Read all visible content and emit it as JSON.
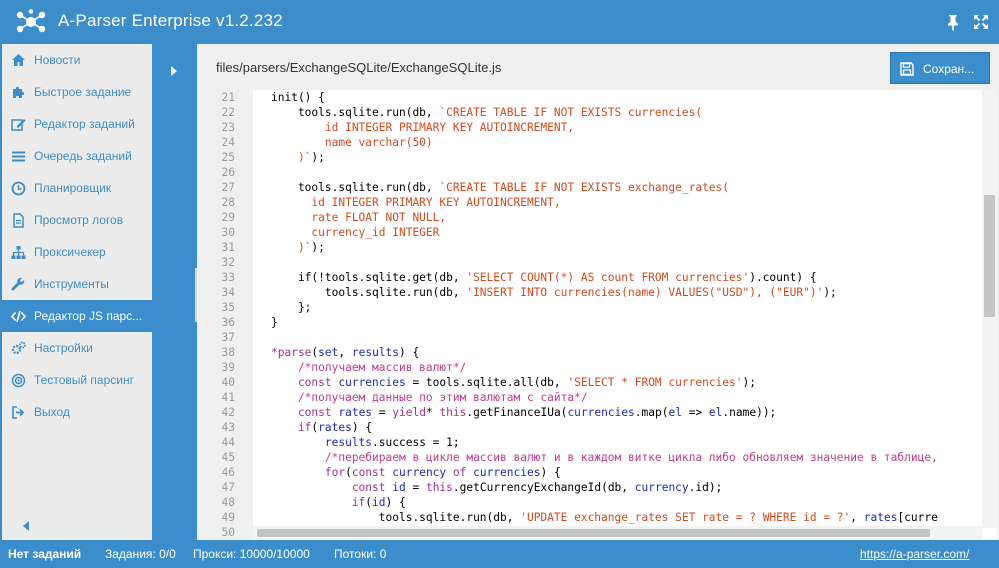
{
  "app": {
    "title": "A-Parser Enterprise v1.2.232"
  },
  "icons": {
    "logo": "a-parser-logo-icon",
    "pin": "pin-icon",
    "fullscreen": "fullscreen-icon"
  },
  "colors": {
    "accent": "#3c8dcb",
    "sidebar_bg": "#ececec",
    "active_bg": "#3c8dcb",
    "string": "#d14b1e",
    "comment": "#c43c8a",
    "keyword": "#a0328e",
    "variable": "#1f2ab0"
  },
  "sidebar": {
    "items": [
      {
        "label": "Новости",
        "icon": "home-icon",
        "active": false
      },
      {
        "label": "Быстрое задание",
        "icon": "puzzle-icon",
        "active": false
      },
      {
        "label": "Редактор заданий",
        "icon": "edit-icon",
        "active": false
      },
      {
        "label": "Очередь заданий",
        "icon": "list-icon",
        "active": false
      },
      {
        "label": "Планировщик",
        "icon": "clock-icon",
        "active": false
      },
      {
        "label": "Просмотр логов",
        "icon": "file-icon",
        "active": false
      },
      {
        "label": "Проксичекер",
        "icon": "sitemap-icon",
        "active": false
      },
      {
        "label": "Инструменты",
        "icon": "wrench-icon",
        "active": false
      },
      {
        "label": "Редактор JS парс...",
        "icon": "code-icon",
        "active": true
      },
      {
        "label": "Настройки",
        "icon": "gears-icon",
        "active": false
      },
      {
        "label": "Тестовый парсинг",
        "icon": "target-icon",
        "active": false
      },
      {
        "label": "Выход",
        "icon": "signout-icon",
        "active": false
      }
    ]
  },
  "content": {
    "file_path": "files/parsers/ExchangeSQLite/ExchangeSQLite.js",
    "save_label": "Сохран...",
    "save_icon": "save-icon"
  },
  "editor": {
    "lines": [
      {
        "num": "21",
        "tokens": [
          [
            "d",
            "init() {"
          ]
        ]
      },
      {
        "num": "22",
        "tokens": [
          [
            "d",
            "    tools.sqlite.run(db, "
          ],
          [
            "s",
            "`CREATE TABLE IF NOT EXISTS currencies("
          ]
        ]
      },
      {
        "num": "23",
        "tokens": [
          [
            "s",
            "        id INTEGER PRIMARY KEY AUTOINCREMENT,"
          ]
        ]
      },
      {
        "num": "24",
        "tokens": [
          [
            "s",
            "        name varchar(50)"
          ]
        ]
      },
      {
        "num": "25",
        "tokens": [
          [
            "s",
            "    )`"
          ],
          [
            "d",
            ");"
          ]
        ]
      },
      {
        "num": "26",
        "tokens": []
      },
      {
        "num": "27",
        "tokens": [
          [
            "d",
            "    tools.sqlite.run(db, "
          ],
          [
            "s",
            "`CREATE TABLE IF NOT EXISTS exchange_rates("
          ]
        ]
      },
      {
        "num": "28",
        "tokens": [
          [
            "s",
            "      id INTEGER PRIMARY KEY AUTOINCREMENT,"
          ]
        ]
      },
      {
        "num": "29",
        "tokens": [
          [
            "s",
            "      rate FLOAT NOT NULL,"
          ]
        ]
      },
      {
        "num": "30",
        "tokens": [
          [
            "s",
            "      currency_id INTEGER"
          ]
        ]
      },
      {
        "num": "31",
        "tokens": [
          [
            "s",
            "    )`"
          ],
          [
            "d",
            ");"
          ]
        ]
      },
      {
        "num": "32",
        "tokens": []
      },
      {
        "num": "33",
        "tokens": [
          [
            "d",
            "    if(!tools.sqlite.get(db, "
          ],
          [
            "s",
            "'SELECT COUNT(*) AS count FROM currencies'"
          ],
          [
            "d",
            ").count) {"
          ]
        ]
      },
      {
        "num": "34",
        "tokens": [
          [
            "d",
            "        tools.sqlite.run(db, "
          ],
          [
            "s",
            "'INSERT INTO currencies(name) VALUES(\"USD\"), (\"EUR\")'"
          ],
          [
            "d",
            ");"
          ]
        ]
      },
      {
        "num": "35",
        "tokens": [
          [
            "d",
            "    };"
          ]
        ]
      },
      {
        "num": "36",
        "tokens": [
          [
            "d",
            "}"
          ]
        ]
      },
      {
        "num": "37",
        "tokens": []
      },
      {
        "num": "38",
        "tokens": [
          [
            "k",
            "*parse"
          ],
          [
            "d",
            "("
          ],
          [
            "v",
            "set"
          ],
          [
            "d",
            ", "
          ],
          [
            "v",
            "results"
          ],
          [
            "d",
            ") {"
          ]
        ]
      },
      {
        "num": "39",
        "tokens": [
          [
            "c",
            "    /*получаем массив валют*/"
          ]
        ]
      },
      {
        "num": "40",
        "tokens": [
          [
            "k",
            "    const "
          ],
          [
            "v",
            "currencies"
          ],
          [
            "d",
            " = tools.sqlite.all(db, "
          ],
          [
            "s",
            "'SELECT * FROM currencies'"
          ],
          [
            "d",
            ");"
          ]
        ]
      },
      {
        "num": "41",
        "tokens": [
          [
            "c",
            "    /*получаем данные по этим валютам с сайта*/"
          ]
        ]
      },
      {
        "num": "42",
        "tokens": [
          [
            "k",
            "    const "
          ],
          [
            "v",
            "rates"
          ],
          [
            "d",
            " = "
          ],
          [
            "k",
            "yield"
          ],
          [
            "d",
            "* "
          ],
          [
            "k",
            "this"
          ],
          [
            "d",
            ".getFinanceIUa("
          ],
          [
            "v",
            "currencies"
          ],
          [
            "d",
            ".map("
          ],
          [
            "v",
            "el"
          ],
          [
            "d",
            " => "
          ],
          [
            "v",
            "el"
          ],
          [
            "d",
            ".name));"
          ]
        ]
      },
      {
        "num": "43",
        "tokens": [
          [
            "k",
            "    if"
          ],
          [
            "d",
            "("
          ],
          [
            "v",
            "rates"
          ],
          [
            "d",
            ") {"
          ]
        ]
      },
      {
        "num": "44",
        "tokens": [
          [
            "v",
            "        results"
          ],
          [
            "d",
            ".success = "
          ],
          [
            "d",
            "1;"
          ]
        ]
      },
      {
        "num": "45",
        "tokens": [
          [
            "c",
            "        /*перебираем в цикле массив валют и в каждом витке цикла либо обновляем значение в таблице,"
          ]
        ]
      },
      {
        "num": "46",
        "tokens": [
          [
            "k",
            "        for"
          ],
          [
            "d",
            "("
          ],
          [
            "k",
            "const "
          ],
          [
            "v",
            "currency"
          ],
          [
            "k",
            " of "
          ],
          [
            "v",
            "currencies"
          ],
          [
            "d",
            ") {"
          ]
        ]
      },
      {
        "num": "47",
        "tokens": [
          [
            "k",
            "            const "
          ],
          [
            "v",
            "id"
          ],
          [
            "d",
            " = "
          ],
          [
            "k",
            "this"
          ],
          [
            "d",
            ".getCurrencyExchangeId(db, "
          ],
          [
            "v",
            "currency"
          ],
          [
            "d",
            ".id);"
          ]
        ]
      },
      {
        "num": "48",
        "tokens": [
          [
            "k",
            "            if"
          ],
          [
            "d",
            "("
          ],
          [
            "v",
            "id"
          ],
          [
            "d",
            ") {"
          ]
        ]
      },
      {
        "num": "49",
        "tokens": [
          [
            "d",
            "                tools.sqlite.run(db, "
          ],
          [
            "s",
            "'UPDATE exchange_rates SET rate = ? WHERE id = ?'"
          ],
          [
            "d",
            ", "
          ],
          [
            "v",
            "rates"
          ],
          [
            "d",
            "[curre"
          ]
        ]
      },
      {
        "num": "50",
        "tokens": []
      }
    ]
  },
  "status": {
    "tasks": "Нет заданий",
    "jobs": "Задания: 0/0",
    "proxies": "Прокси: 10000/10000",
    "threads": "Потоки: 0",
    "link": "https://a-parser.com/"
  }
}
